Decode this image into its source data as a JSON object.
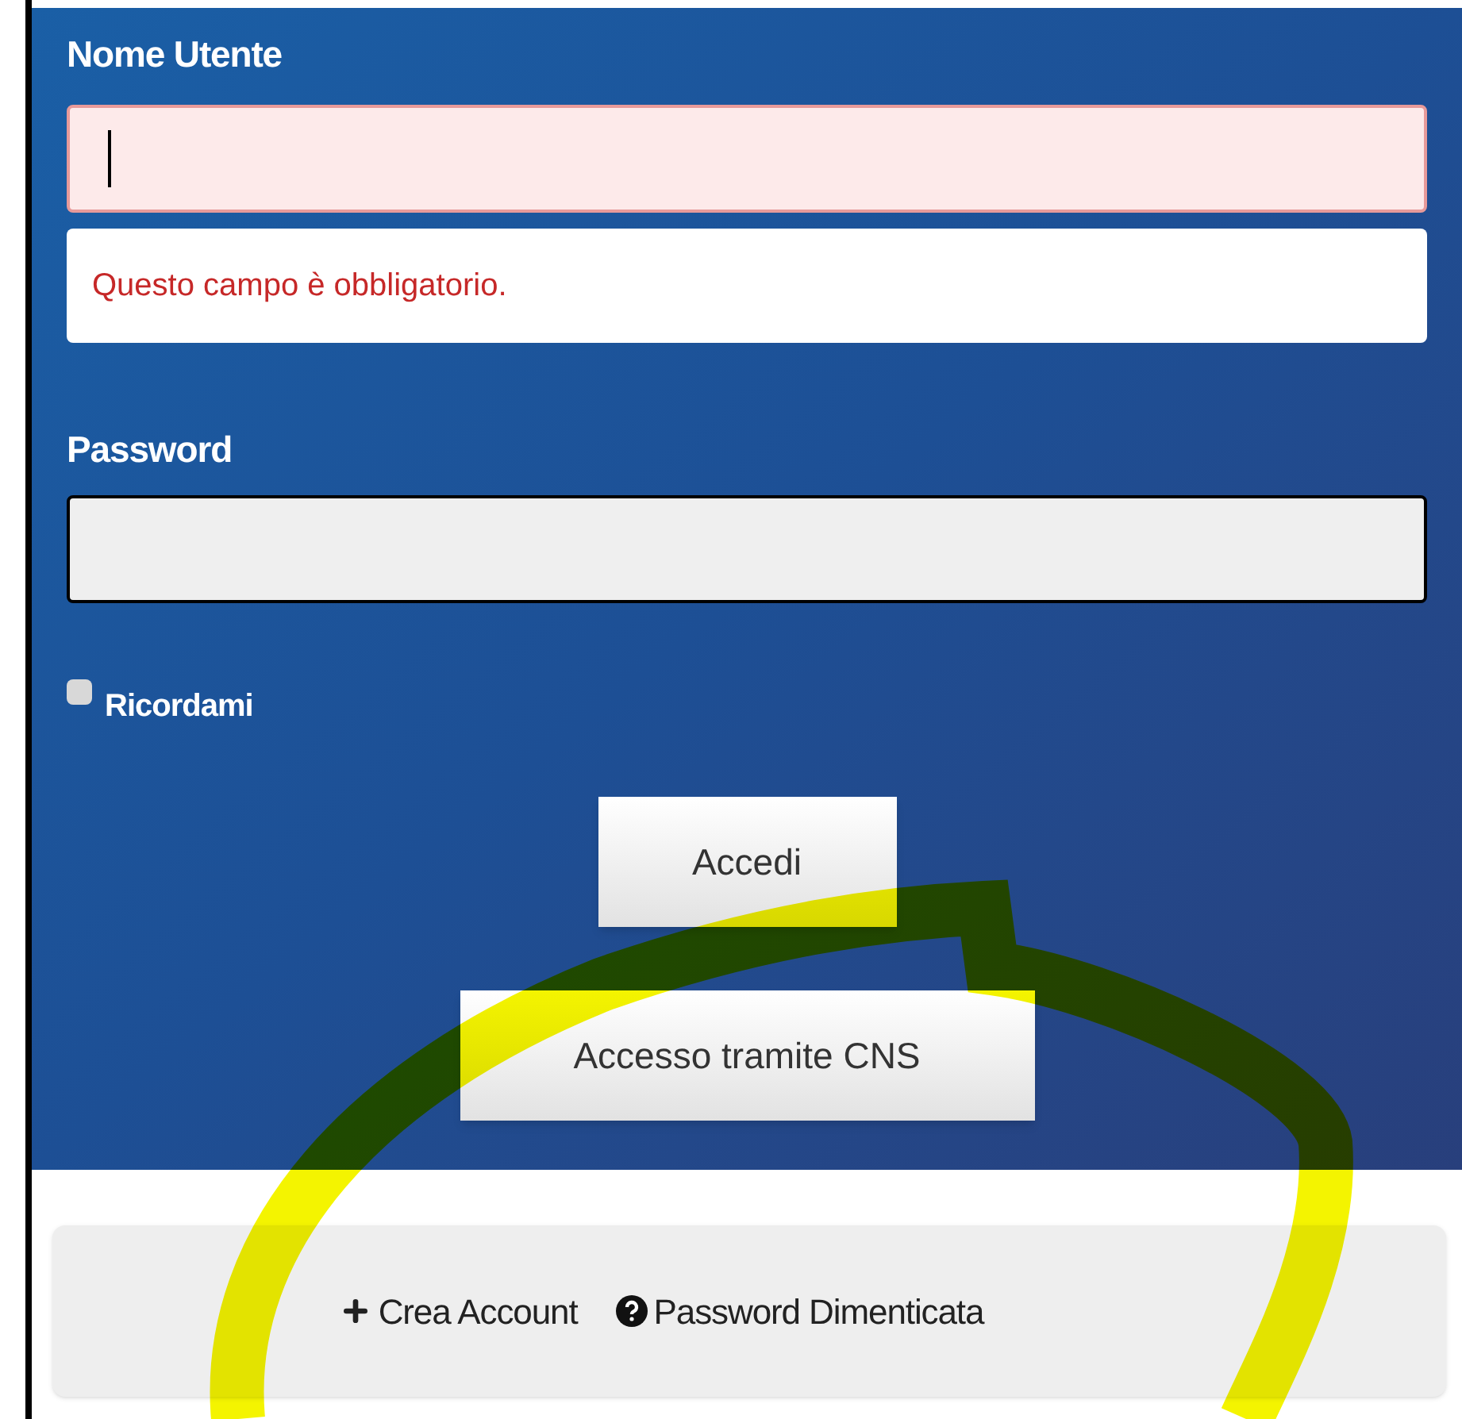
{
  "username": {
    "label": "Nome Utente",
    "error": true,
    "focused": true,
    "error_message": "Questo campo è obbligatorio."
  },
  "password": {
    "label": "Password"
  },
  "remember": {
    "label": "Ricordami",
    "checked": false
  },
  "buttons": [
    {
      "label": "Accedi"
    },
    {
      "label": "Accesso tramite CNS"
    }
  ],
  "links": [
    {
      "kind": "create",
      "label": "Crea Account"
    },
    {
      "kind": "help",
      "label": "Password Dimenticata"
    }
  ],
  "annotation": {
    "kind": "highlighter"
  }
}
